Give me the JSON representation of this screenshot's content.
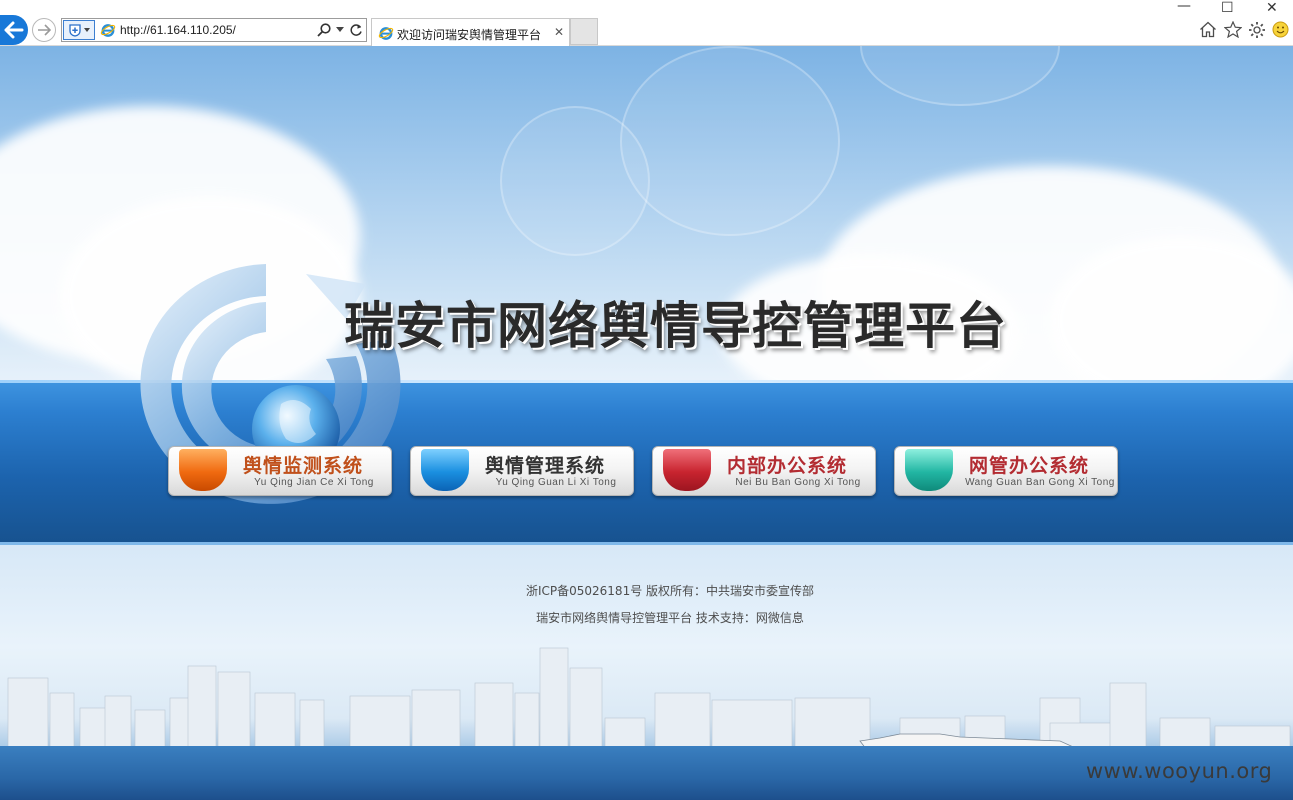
{
  "browser": {
    "url": "http://61.164.110.205/",
    "tab_title": "欢迎访问瑞安舆情管理平台",
    "tab_close": "✕",
    "window_controls": [
      "—",
      "☐",
      "✕"
    ],
    "toolbar_icons": [
      "home-icon",
      "star-icon",
      "gear-icon",
      "smiley-icon"
    ]
  },
  "page": {
    "title": "瑞安市网络舆情导控管理平台",
    "systems": [
      {
        "name": "舆情监测系统",
        "pinyin": "Yu Qing Jian Ce Xi Tong",
        "icon_color": "#f06a10",
        "text_color": "#c0501b"
      },
      {
        "name": "舆情管理系统",
        "pinyin": "Yu Qing Guan Li  Xi Tong",
        "icon_color": "#1a8fe0",
        "text_color": "#333333"
      },
      {
        "name": "内部办公系统",
        "pinyin": "Nei Bu Ban Gong Xi Tong",
        "icon_color": "#c8242f",
        "text_color": "#b32c32"
      },
      {
        "name": "网管办公系统",
        "pinyin": "Wang Guan Ban Gong Xi Tong",
        "icon_color": "#22b6a3",
        "text_color": "#b32c32"
      }
    ],
    "footer": {
      "line1": "浙ICP备05026181号  版权所有：中共瑞安市委宣传部",
      "line2": "瑞安市网络舆情导控管理平台  技术支持：网微信息"
    },
    "watermark": "www.wooyun.org"
  }
}
